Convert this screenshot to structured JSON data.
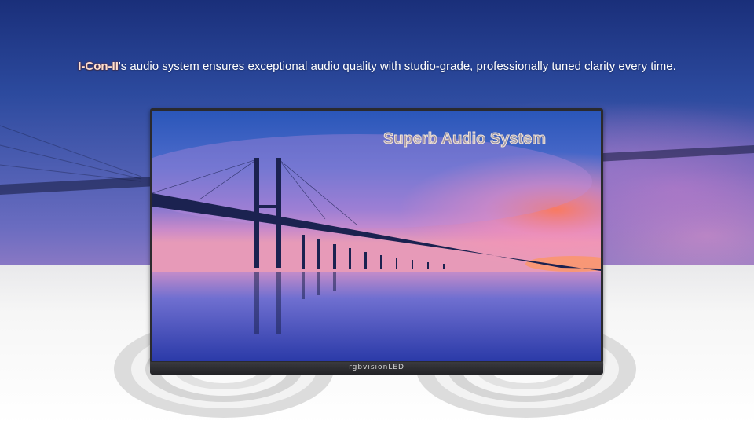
{
  "headline": {
    "brand": "I-Con-II",
    "text": "'s audio system ensures exceptional audio quality with studio-grade, professionally tuned clarity every time."
  },
  "screen": {
    "title": "Superb Audio System"
  },
  "monitor": {
    "brand_label": "rgbvisionLED"
  },
  "colors": {
    "sky_top": "#1a2f7a",
    "sky_bottom": "#8a78c4",
    "sunset": "#ff7a5a",
    "frame": "#2a2a2e"
  }
}
